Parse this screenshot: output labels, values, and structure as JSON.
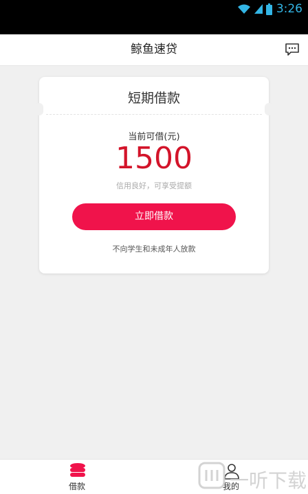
{
  "status_bar": {
    "time": "3:26",
    "icons": [
      "wifi-icon",
      "signal-icon",
      "battery-icon"
    ]
  },
  "header": {
    "title": "鲸鱼速贷",
    "message_icon": "chat-icon"
  },
  "loan_card": {
    "title": "短期借款",
    "available_label": "当前可借(元)",
    "amount": "1500",
    "credit_note": "信用良好，可享受提额",
    "button_label": "立即借款",
    "disclaimer": "不向学生和未成年人放款"
  },
  "tab_bar": {
    "tabs": [
      {
        "label": "借款",
        "icon": "coins-icon",
        "active": true
      },
      {
        "label": "我的",
        "icon": "user-icon",
        "active": false
      }
    ]
  },
  "watermark": {
    "text": "一听下载"
  },
  "colors": {
    "accent": "#f0134b",
    "amount": "#d3142a",
    "status_icons": "#33b5e5"
  }
}
